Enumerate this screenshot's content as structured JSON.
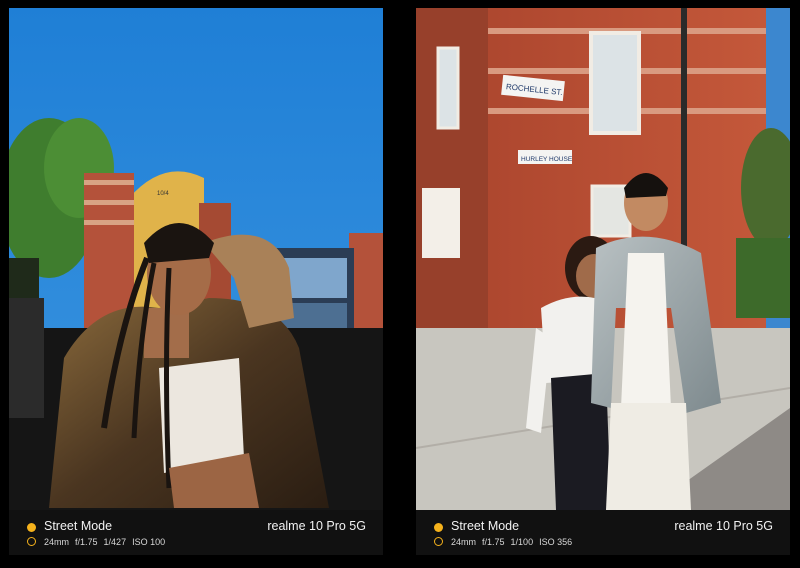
{
  "accent_color": "#f5b21c",
  "photos": [
    {
      "mode": "Street Mode",
      "focal": "24mm",
      "aperture": "f/1.75",
      "shutter": "1/427",
      "iso": "ISO 100",
      "device": "realme 10 Pro 5G",
      "sign_text": "10/4"
    },
    {
      "mode": "Street Mode",
      "focal": "24mm",
      "aperture": "f/1.75",
      "shutter": "1/100",
      "iso": "ISO 356",
      "device": "realme 10 Pro 5G",
      "street_sign": "ROCHELLE ST.",
      "house_sign": "HURLEY HOUSE"
    }
  ]
}
